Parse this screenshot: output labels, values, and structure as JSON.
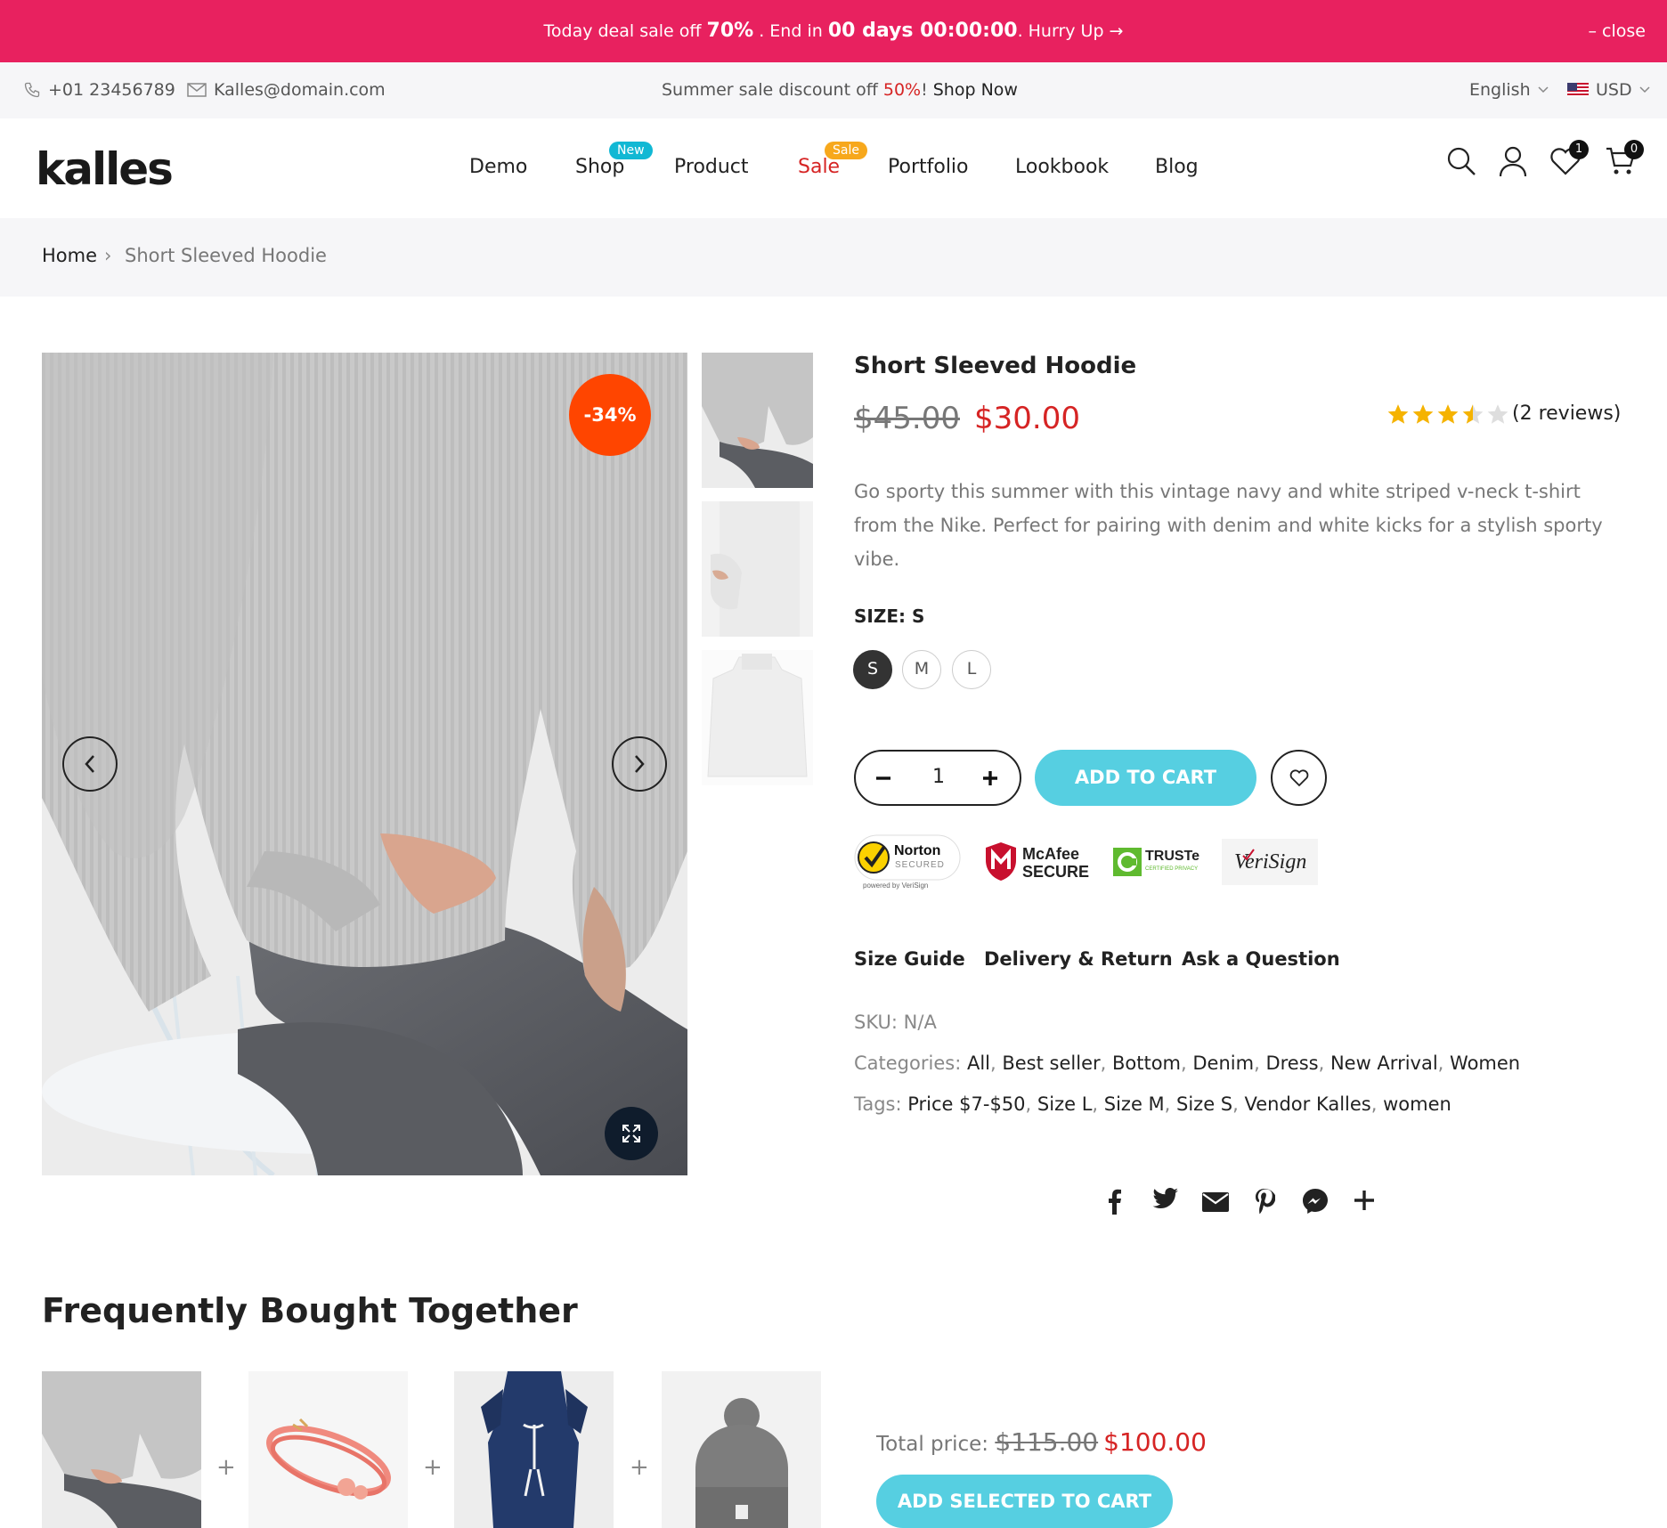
{
  "announcement": {
    "pre": "Today deal sale off ",
    "percent": "70%",
    "mid": " . End in ",
    "timer": "00 days 00:00:00",
    "post": ". Hurry Up →",
    "close": "– close"
  },
  "topbar": {
    "phone": "+01 23456789",
    "email": "Kalles@domain.com",
    "promo_pre": "Summer sale discount off ",
    "promo_percent": "50%",
    "promo_excl": "! ",
    "promo_link": "Shop Now",
    "language": "English",
    "currency": "USD"
  },
  "header": {
    "logo": "kalles",
    "nav": [
      {
        "label": "Demo"
      },
      {
        "label": "Shop",
        "badge": "New"
      },
      {
        "label": "Product"
      },
      {
        "label": "Sale",
        "badge": "Sale"
      },
      {
        "label": "Portfolio"
      },
      {
        "label": "Lookbook"
      },
      {
        "label": "Blog"
      }
    ],
    "wishlist_count": "1",
    "cart_count": "0"
  },
  "breadcrumb": {
    "home": "Home",
    "separator": "›",
    "current": "Short Sleeved Hoodie"
  },
  "gallery": {
    "discount_badge": "-34%"
  },
  "product": {
    "title": "Short Sleeved Hoodie",
    "old_price": "$45.00",
    "price": "$30.00",
    "rating": 3.5,
    "rating_max": 5,
    "reviews": "(2 reviews)",
    "description": "Go sporty this summer with this vintage navy and white striped v-neck t-shirt from the Nike. Perfect for pairing with denim and white kicks for a stylish sporty vibe.",
    "size_label": "SIZE: S",
    "sizes": [
      "S",
      "M",
      "L"
    ],
    "selected_size": "S",
    "quantity": "1",
    "add_to_cart": "ADD TO CART",
    "trust_badges": {
      "norton": "Norton",
      "norton_sub": "SECURED",
      "norton_by": "powered by VeriSign",
      "mcafee": "McAfee",
      "mcafee_sub": "SECURE",
      "truste": "TRUSTe",
      "truste_sub": "CERTIFIED PRIVACY",
      "verisign": "VeriSign"
    },
    "tabs": [
      "Size Guide",
      "Delivery & Return",
      "Ask a Question"
    ],
    "sku_label": "SKU: ",
    "sku": "N/A",
    "categories_label": "Categories: ",
    "categories": [
      "All",
      "Best seller",
      "Bottom",
      "Denim",
      "Dress",
      "New Arrival",
      "Women"
    ],
    "tags_label": "Tags: ",
    "tags": [
      "Price $7-$50",
      "Size L",
      "Size M",
      "Size S",
      "Vendor Kalles",
      "women"
    ]
  },
  "fbt": {
    "title": "Frequently Bought Together",
    "total_label": "Total price: ",
    "total_old": "$115.00",
    "total_new": "$100.00",
    "button": "ADD SELECTED TO CART"
  },
  "colors": {
    "accent_pink": "#e8215f",
    "sale_red": "#d62424",
    "cart_cyan": "#56cfe1",
    "badge_orange": "#ff4500",
    "star_gold": "#f5b301"
  }
}
